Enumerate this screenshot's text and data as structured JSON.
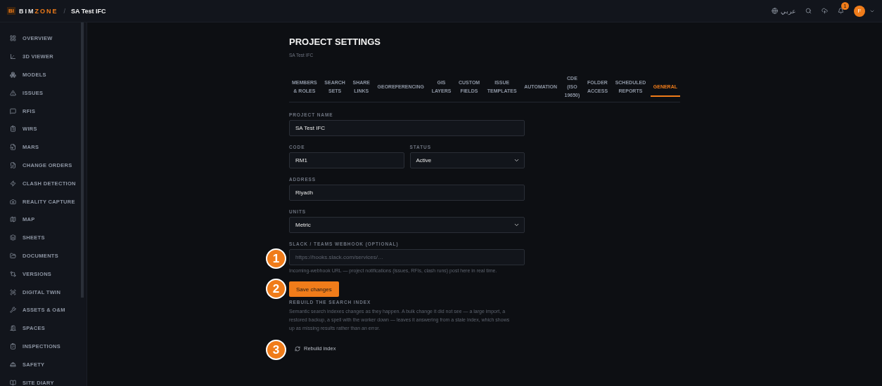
{
  "topbar": {
    "logo": {
      "mark": "BI",
      "name_light": "BIM",
      "name_accent": "ZONE"
    },
    "separator": "/",
    "project": "SA Test IFC",
    "language": "عربي",
    "notifications": "1",
    "avatar": "F"
  },
  "sidebar": {
    "items": [
      {
        "label": "OVERVIEW",
        "selected": false
      },
      {
        "label": "3D VIEWER",
        "selected": false
      },
      {
        "label": "MODELS",
        "selected": false
      },
      {
        "label": "ISSUES",
        "selected": false
      },
      {
        "label": "RFIS",
        "selected": false
      },
      {
        "label": "WIRS",
        "selected": false
      },
      {
        "label": "MARS",
        "selected": false
      },
      {
        "label": "CHANGE ORDERS",
        "selected": false
      },
      {
        "label": "CLASH DETECTION",
        "selected": false
      },
      {
        "label": "REALITY CAPTURE",
        "selected": false
      },
      {
        "label": "MAP",
        "selected": false
      },
      {
        "label": "SHEETS",
        "selected": false
      },
      {
        "label": "DOCUMENTS",
        "selected": false
      },
      {
        "label": "VERSIONS",
        "selected": false
      },
      {
        "label": "DIGITAL TWIN",
        "selected": false
      },
      {
        "label": "ASSETS & O&M",
        "selected": false
      },
      {
        "label": "SPACES",
        "selected": false
      },
      {
        "label": "INSPECTIONS",
        "selected": false
      },
      {
        "label": "SAFETY",
        "selected": false
      },
      {
        "label": "SITE DIARY",
        "selected": false
      }
    ]
  },
  "page": {
    "title": "PROJECT SETTINGS",
    "subtitle": "SA Test IFC"
  },
  "tabs": [
    {
      "label": "MEMBERS\n& ROLES",
      "selected": false
    },
    {
      "label": "SEARCH\nSETS",
      "selected": false
    },
    {
      "label": "SHARE\nLINKS",
      "selected": false
    },
    {
      "label": "GEOREFERENCING",
      "selected": false
    },
    {
      "label": "GIS\nLAYERS",
      "selected": false
    },
    {
      "label": "CUSTOM\nFIELDS",
      "selected": false
    },
    {
      "label": "ISSUE\nTEMPLATES",
      "selected": false
    },
    {
      "label": "AUTOMATION",
      "selected": false
    },
    {
      "label": "CDE\n(ISO\n19650)",
      "selected": false
    },
    {
      "label": "FOLDER\nACCESS",
      "selected": false
    },
    {
      "label": "SCHEDULED\nREPORTS",
      "selected": false
    },
    {
      "label": "GENERAL",
      "selected": true
    }
  ],
  "form": {
    "rows": [
      [
        {
          "kind": "text",
          "label": "PROJECT NAME",
          "value": "SA Test IFC"
        }
      ],
      [
        {
          "kind": "text",
          "label": "CODE",
          "value": "RM1"
        },
        {
          "kind": "select",
          "label": "STATUS",
          "value": "Active"
        }
      ],
      [
        {
          "kind": "text",
          "label": "ADDRESS",
          "value": "Riyadh"
        }
      ],
      [
        {
          "kind": "select",
          "label": "UNITS",
          "value": "Metric"
        }
      ],
      [
        {
          "kind": "text",
          "label": "SLACK / TEAMS WEBHOOK (OPTIONAL)",
          "placeholder": "https://hooks.slack.com/services/…",
          "hint": "Incoming-webhook URL — project notifications (issues, RFIs, clash runs) post here in real time.",
          "callout": "1"
        }
      ]
    ],
    "save_button": {
      "label": "Save changes",
      "callout": "2"
    }
  },
  "rebuild": {
    "heading": "REBUILD THE SEARCH INDEX",
    "text": "Semantic search indexes changes as they happen. A bulk change it did not see — a large import, a restored backup, a spell with the worker down — leaves it answering from a stale index, which shows up as missing results rather than an error.",
    "button": "Rebuild index",
    "callout": "3"
  }
}
